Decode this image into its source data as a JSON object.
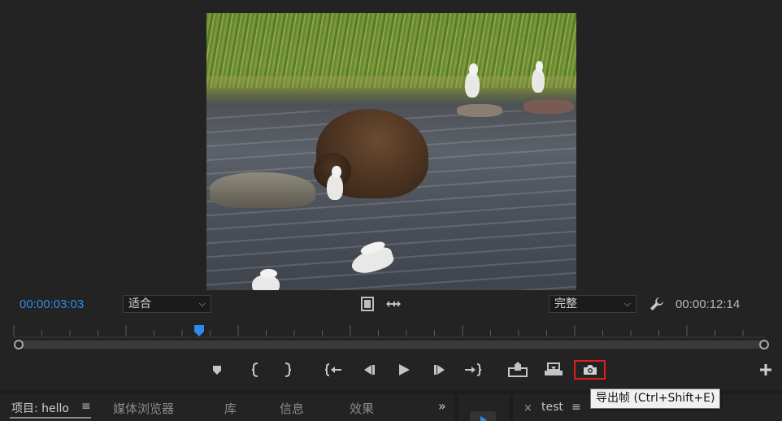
{
  "program_monitor": {
    "current_timecode": "00:00:03:03",
    "duration_timecode": "00:00:12:14",
    "zoom_select": {
      "value": "适合",
      "arrow": "⌵"
    },
    "quality_select": {
      "value": "完整",
      "arrow": "⌵"
    },
    "playhead_position": 0.244
  },
  "transport": {
    "buttons": [
      {
        "name": "add-marker",
        "icon": "marker-icon"
      },
      {
        "name": "mark-in",
        "icon": "mark-in-icon"
      },
      {
        "name": "mark-out",
        "icon": "mark-out-icon"
      },
      {
        "name": "go-to-in",
        "icon": "go-to-in-icon"
      },
      {
        "name": "step-back",
        "icon": "step-back-icon"
      },
      {
        "name": "play",
        "icon": "play-icon"
      },
      {
        "name": "step-forward",
        "icon": "step-forward-icon"
      },
      {
        "name": "go-to-out",
        "icon": "go-to-out-icon"
      },
      {
        "name": "lift",
        "icon": "lift-icon"
      },
      {
        "name": "extract",
        "icon": "extract-icon"
      },
      {
        "name": "export-frame",
        "icon": "camera-icon"
      },
      {
        "name": "add-button",
        "icon": "plus-icon"
      }
    ],
    "highlight_color": "#e01e1e"
  },
  "tooltip": {
    "text": "导出帧 (Ctrl+Shift+E)"
  },
  "panels": {
    "project": {
      "label": "项目: hello",
      "menu": "≡"
    },
    "tabs": [
      "媒体浏览器",
      "库",
      "信息",
      "效果"
    ],
    "overflow": "»",
    "timeline": {
      "close": "×",
      "name": "test",
      "menu": "≡"
    }
  },
  "colors": {
    "timecode_accent": "#2d8ceb",
    "background": "#232323"
  }
}
